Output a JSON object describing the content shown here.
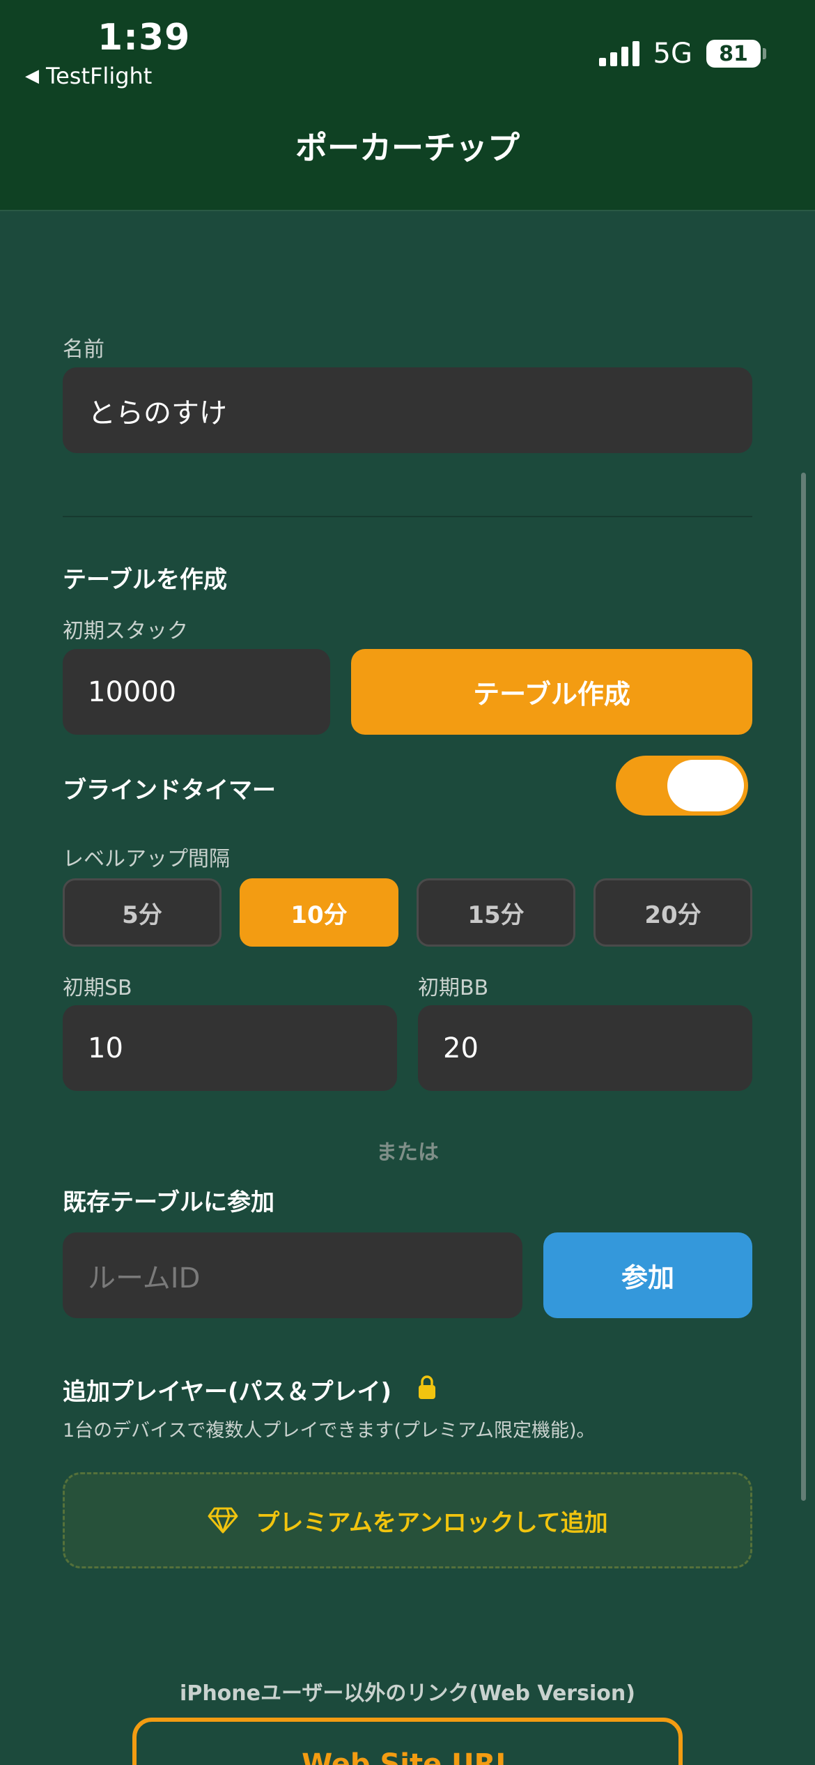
{
  "status_bar": {
    "time": "1:39",
    "back_label": "TestFlight",
    "network": "5G",
    "battery": "81"
  },
  "header": {
    "title": "ポーカーチップ"
  },
  "name_section": {
    "label": "名前",
    "value": "とらのすけ"
  },
  "create_table": {
    "title": "テーブルを作成",
    "stack_label": "初期スタック",
    "stack_value": "10000",
    "create_button": "テーブル作成",
    "blind_timer_label": "ブラインドタイマー",
    "blind_timer_on": true,
    "interval_label": "レベルアップ間隔",
    "intervals": [
      "5分",
      "10分",
      "15分",
      "20分"
    ],
    "selected_interval": "10分",
    "sb_label": "初期SB",
    "sb_value": "10",
    "bb_label": "初期BB",
    "bb_value": "20"
  },
  "or_text": "または",
  "join_table": {
    "title": "既存テーブルに参加",
    "room_placeholder": "ルームID",
    "join_button": "参加"
  },
  "extra_players": {
    "title": "追加プレイヤー(パス＆プレイ)",
    "description": "1台のデバイスで複数人プレイできます(プレミアム限定機能)。",
    "unlock_button": "プレミアムをアンロックして追加"
  },
  "web_version": {
    "caption": "iPhoneユーザー以外のリンク(Web Version)",
    "button": "Web Site URL"
  },
  "colors": {
    "background": "#1c4a3c",
    "header": "#0f4123",
    "accent_orange": "#f39c12",
    "accent_blue": "#3498db",
    "premium_yellow": "#f1c40f",
    "field": "#333333"
  },
  "icons": {
    "back": "back-arrow-icon",
    "lock": "lock-icon",
    "premium": "diamond-icon"
  }
}
